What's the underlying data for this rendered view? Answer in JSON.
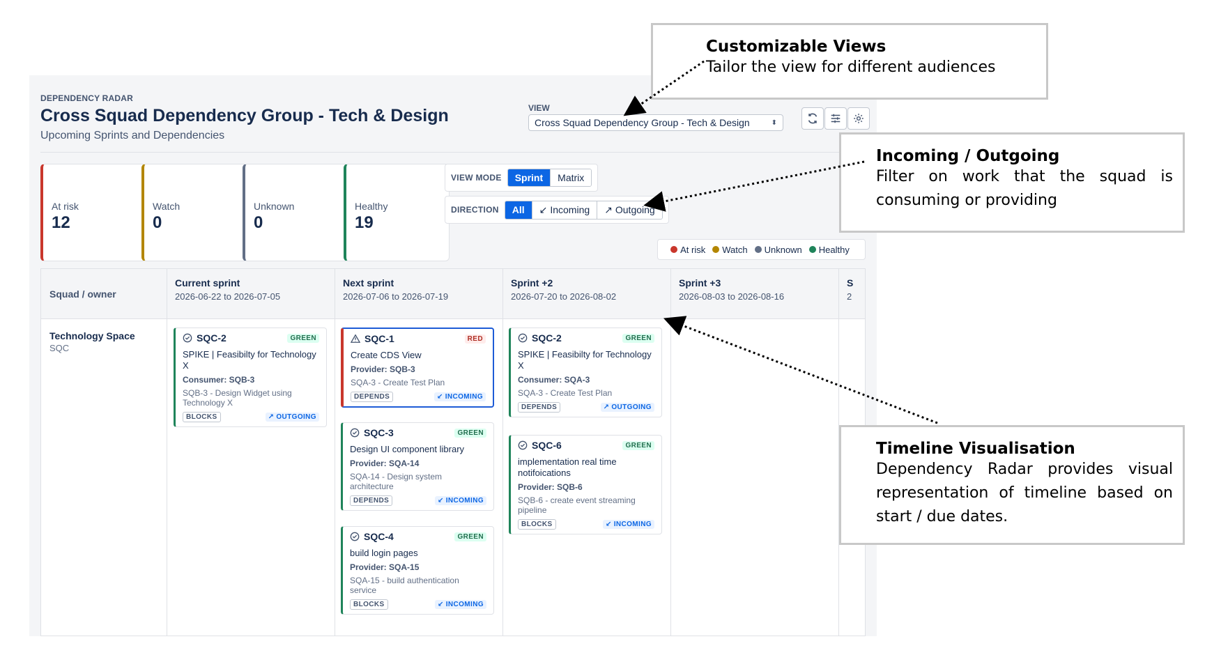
{
  "header": {
    "kicker": "DEPENDENCY RADAR",
    "title": "Cross Squad Dependency Group - Tech & Design",
    "subtitle": "Upcoming Sprints and Dependencies"
  },
  "view": {
    "label": "VIEW",
    "selected": "Cross Squad Dependency Group - Tech & Design",
    "icons": [
      "refresh-icon",
      "filter-sliders-icon",
      "settings-gear-icon"
    ]
  },
  "stats": [
    {
      "label": "At risk",
      "value": "12",
      "color": "#c9372c"
    },
    {
      "label": "Watch",
      "value": "0",
      "color": "#b38600"
    },
    {
      "label": "Unknown",
      "value": "0",
      "color": "#626f86"
    },
    {
      "label": "Healthy",
      "value": "19",
      "color": "#1f845a"
    }
  ],
  "view_mode": {
    "label": "VIEW MODE",
    "options": [
      "Sprint",
      "Matrix"
    ],
    "selected": "Sprint"
  },
  "direction": {
    "label": "DIRECTION",
    "options": [
      "All",
      "Incoming",
      "Outgoing"
    ],
    "selected": "All"
  },
  "legend": [
    {
      "label": "At risk",
      "color": "#c9372c"
    },
    {
      "label": "Watch",
      "color": "#b38600"
    },
    {
      "label": "Unknown",
      "color": "#626f86"
    },
    {
      "label": "Healthy",
      "color": "#1f845a"
    }
  ],
  "grid": {
    "squad_header": "Squad / owner",
    "columns": [
      {
        "name": "Current sprint",
        "dates": "2026-06-22 to 2026-07-05"
      },
      {
        "name": "Next sprint",
        "dates": "2026-07-06 to 2026-07-19"
      },
      {
        "name": "Sprint +2",
        "dates": "2026-07-20 to 2026-08-02"
      },
      {
        "name": "Sprint +3",
        "dates": "2026-08-03 to 2026-08-16"
      },
      {
        "name": "S",
        "dates": "2"
      }
    ],
    "squad": {
      "name": "Technology Space",
      "code": "SQC"
    }
  },
  "cards": [
    {
      "key": "SQC-2",
      "status": "GREEN",
      "title": "SPIKE | Feasibilty for Technology X",
      "rel": "Consumer: SQB-3",
      "rel_item": "SQB-3 - Design Widget using Technology X",
      "type": "BLOCKS",
      "direction": "OUTGOING"
    },
    {
      "key": "SQC-1",
      "status": "RED",
      "title": "Create CDS View",
      "rel": "Provider: SQB-3",
      "rel_item": "SQA-3 - Create Test Plan",
      "type": "DEPENDS",
      "direction": "INCOMING"
    },
    {
      "key": "SQC-3",
      "status": "GREEN",
      "title": "Design UI component library",
      "rel": "Provider: SQA-14",
      "rel_item": "SQA-14 - Design system architecture",
      "type": "DEPENDS",
      "direction": "INCOMING"
    },
    {
      "key": "SQC-4",
      "status": "GREEN",
      "title": "build login pages",
      "rel": "Provider: SQA-15",
      "rel_item": "SQA-15 - build authentication service",
      "type": "BLOCKS",
      "direction": "INCOMING"
    },
    {
      "key": "SQC-2",
      "status": "GREEN",
      "title": "SPIKE | Feasibilty for Technology X",
      "rel": "Consumer: SQA-3",
      "rel_item": "SQA-3 - Create Test Plan",
      "type": "DEPENDS",
      "direction": "OUTGOING"
    },
    {
      "key": "SQC-6",
      "status": "GREEN",
      "title": "implementation real time notifoications",
      "rel": "Provider: SQB-6",
      "rel_item": "SQB-6 - create event streaming pipeline",
      "type": "BLOCKS",
      "direction": "INCOMING"
    }
  ],
  "annotations": {
    "views": {
      "heading": "Customizable Views",
      "body": "Tailor the view for different audiences"
    },
    "direction": {
      "heading": "Incoming / Outgoing",
      "body": "Filter on work that the squad is consuming or providing"
    },
    "timeline": {
      "heading": "Timeline Visualisation",
      "body": "Dependency Radar provides visual representation of timeline based on start / due dates."
    }
  }
}
